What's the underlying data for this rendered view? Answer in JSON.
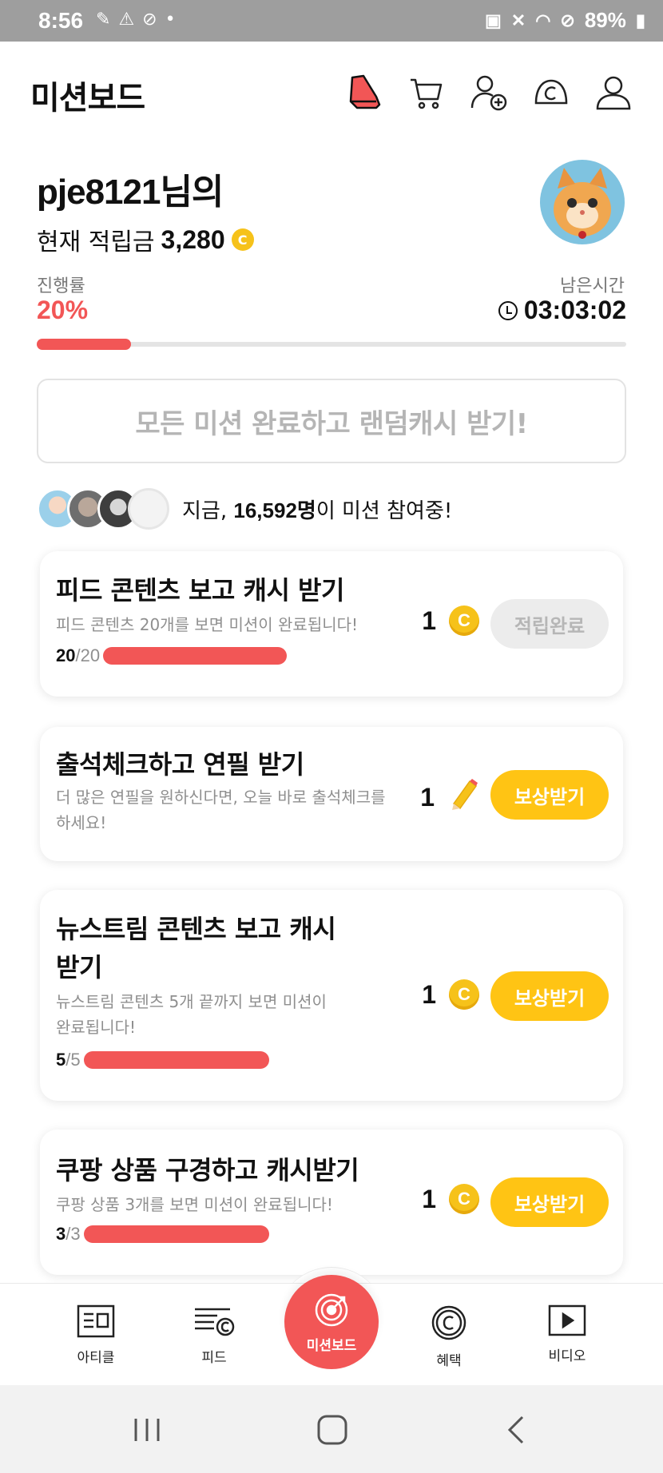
{
  "status_bar": {
    "time": "8:56",
    "battery": "89%",
    "icons": [
      "notification-icon",
      "notification-icon",
      "link-icon",
      "dot-icon",
      "battery-saver-icon",
      "mute-icon",
      "wifi-icon",
      "do-not-disturb-icon",
      "battery-icon"
    ]
  },
  "header": {
    "title": "미션보드",
    "icons": [
      "sneaker-icon",
      "cart-icon",
      "add-friend-icon",
      "cash-icon",
      "profile-icon"
    ]
  },
  "profile": {
    "name": "pje8121님의",
    "points_label": "현재 적립금",
    "points_value": "3,280",
    "coin_symbol": "C"
  },
  "progress": {
    "label": "진행률",
    "percent_text": "20%",
    "fraction": 0.2,
    "remaining_label": "남은시간",
    "remaining_time": "03:03:02"
  },
  "random_cash_button": "모든 미션 완료하고 랜덤캐시 받기!",
  "participants": {
    "prefix": "지금,",
    "count": "16,592명",
    "suffix": "이 미션 참여중!"
  },
  "missions": [
    {
      "title": "피드 콘텐츠 보고 캐시 받기",
      "desc": "피드 콘텐츠 20개를 보면 미션이 완료됩니다!",
      "done": "20",
      "total": "/20",
      "reward": "1",
      "reward_icon": "coin-icon",
      "button": "적립완료",
      "state": "completed"
    },
    {
      "title": "출석체크하고 연필 받기",
      "desc1": "더 많은 연필을 원하신다면, 오늘 바로 출석체크를",
      "desc2": "하세요!",
      "reward": "1",
      "reward_icon": "pencil-icon",
      "button": "보상받기",
      "state": "claimable"
    },
    {
      "title1": "뉴스트림 콘텐츠 보고 캐시",
      "title2": "받기",
      "desc1": "뉴스트림 콘텐츠 5개 끝까지 보면 미션이",
      "desc2": "완료됩니다!",
      "done": "5",
      "total": "/5",
      "reward": "1",
      "reward_icon": "coin-icon",
      "button": "보상받기",
      "state": "claimable"
    },
    {
      "title": "쿠팡 상품 구경하고 캐시받기",
      "desc": "쿠팡 상품 3개를 보면 미션이 완료됩니다!",
      "done": "3",
      "total": "/3",
      "reward": "1",
      "reward_icon": "coin-icon",
      "button": "보상받기",
      "state": "claimable"
    }
  ],
  "bottom_nav": {
    "items": [
      "아티클",
      "피드",
      "미션보드",
      "혜택",
      "비디오"
    ],
    "active": "미션보드"
  },
  "colors": {
    "accent_red": "#f25656",
    "button_yellow": "#ffc414",
    "coin_gold": "#f6c21a"
  }
}
